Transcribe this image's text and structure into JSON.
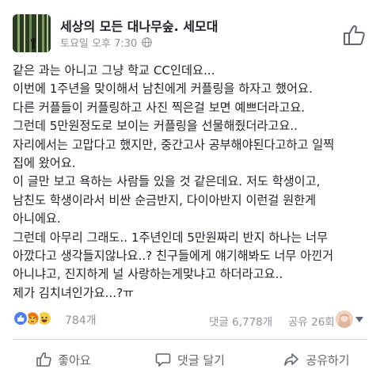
{
  "post": {
    "page_name": "세상의 모든 대나무숲. 세모대",
    "timestamp": "토요일 오후 7:30",
    "privacy_icon": "globe-icon",
    "body_lines": [
      "같은 과는 아니고 그냥 학교 CC인데요...",
      "이번에 1주년을 맞이해서 남친에게 커플링을 하자고 했어요.",
      "다른 커플들이 커플링하고 사진 찍은걸 보면 예쁘더라고요.",
      "그런데 5만원정도로 보이는 커플링을 선물해줬더라고요..",
      "자리에서는 고맙다고 했지만, 중간고사 공부해야된다고하고 일찍",
      "집에 왔어요.",
      "이 글만 보고 욕하는 사람들 있을 것 같은데요. 저도 학생이고,",
      "남친도 학생이라서 비싼 순금반지, 다이아반지 이런걸 원한게",
      "아니에요.",
      "그런데 아무리 그래도.. 1주년인데 5만원짜리 반지 하나는 너무",
      "아깠다고 생각들지않나요..? 친구들에게 얘기해봐도 너무 아낀거",
      "아니냐고, 진지하게 널 사랑하는게맞냐고 하더라고요..",
      "제가 김치녀인가요...?ㅠ"
    ]
  },
  "stats": {
    "reactions": [
      "like-icon",
      "angry-icon",
      "haha-icon"
    ],
    "reaction_count": "784개",
    "comments": "댓글 6,778개",
    "shares": "공유 26회"
  },
  "actions": {
    "like_label": "좋아요",
    "comment_label": "댓글 달기",
    "share_label": "공유하기"
  },
  "colors": {
    "text": "#1d2129",
    "muted": "#90949c",
    "like_blue": "#4a7ff3",
    "angry_orange": "#f3b94a",
    "haha_yellow": "#f7cf46"
  }
}
